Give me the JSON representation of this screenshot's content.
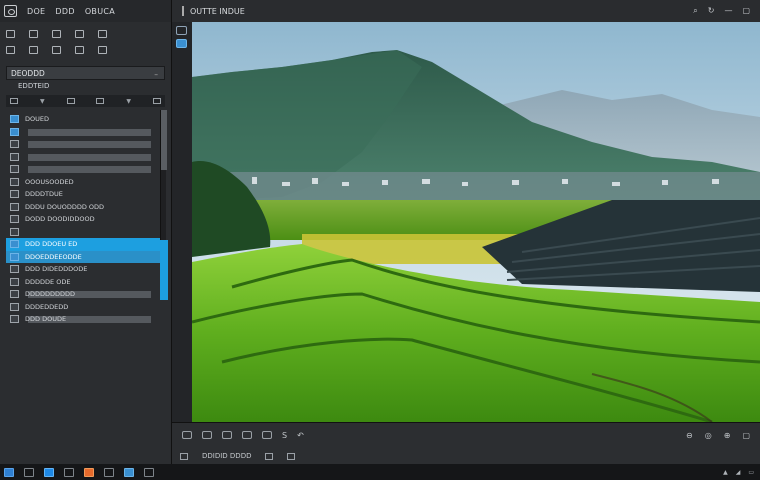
{
  "menubar": {
    "items": [
      "DOE",
      "DDD",
      "OBUCA"
    ]
  },
  "document_tab": {
    "title": "OUTTE  INDUE"
  },
  "panel": {
    "header": "DEODDD",
    "subheader": "EDDTEID",
    "layers": [
      {
        "label": "DOUED",
        "style": "plain",
        "thumb": "blue"
      },
      {
        "label": "",
        "style": "gray-bar",
        "thumb": "blue"
      },
      {
        "label": "",
        "style": "gray-bar",
        "thumb": "plain"
      },
      {
        "label": "",
        "style": "gray-bar",
        "thumb": "plain"
      },
      {
        "label": "",
        "style": "gray-bar",
        "thumb": "plain"
      },
      {
        "label": "OOOUSOODED",
        "style": "plain",
        "thumb": "plain"
      },
      {
        "label": "DDDDTDUE",
        "style": "plain",
        "thumb": "plain"
      },
      {
        "label": "DDDU DOUODDDD ODD",
        "style": "plain",
        "thumb": "plain"
      },
      {
        "label": "DODD DOODIDDOOD",
        "style": "plain",
        "thumb": "plain"
      },
      {
        "label": "",
        "style": "plain",
        "thumb": "plain"
      },
      {
        "label": "DDD DDOEU ED",
        "style": "sel-strong",
        "thumb": "blue"
      },
      {
        "label": "DDOEDDEEODDE",
        "style": "sel-light",
        "thumb": "blue"
      },
      {
        "label": "DDD DIDEDDDODE",
        "style": "plain",
        "thumb": "plain"
      },
      {
        "label": "DDDDDE ODE",
        "style": "plain",
        "thumb": "plain"
      },
      {
        "label": "DDDDDDDDDD",
        "style": "gray-bar",
        "thumb": "plain"
      },
      {
        "label": "DDDEDDEDD",
        "style": "plain",
        "thumb": "plain"
      },
      {
        "label": "DDD DOUDE",
        "style": "gray-bar",
        "thumb": "plain"
      }
    ]
  },
  "status": {
    "label": "DDIDID  DDDD"
  },
  "colors": {
    "accent": "#1d9fe0",
    "panel_bg": "#2b2d30",
    "sky": "#c8dbe6",
    "grass": "#5fae1e"
  },
  "icons": {
    "app_logo": "camera-lens-icon",
    "start": "windows-start-icon",
    "browser": "edge-browser-icon"
  }
}
